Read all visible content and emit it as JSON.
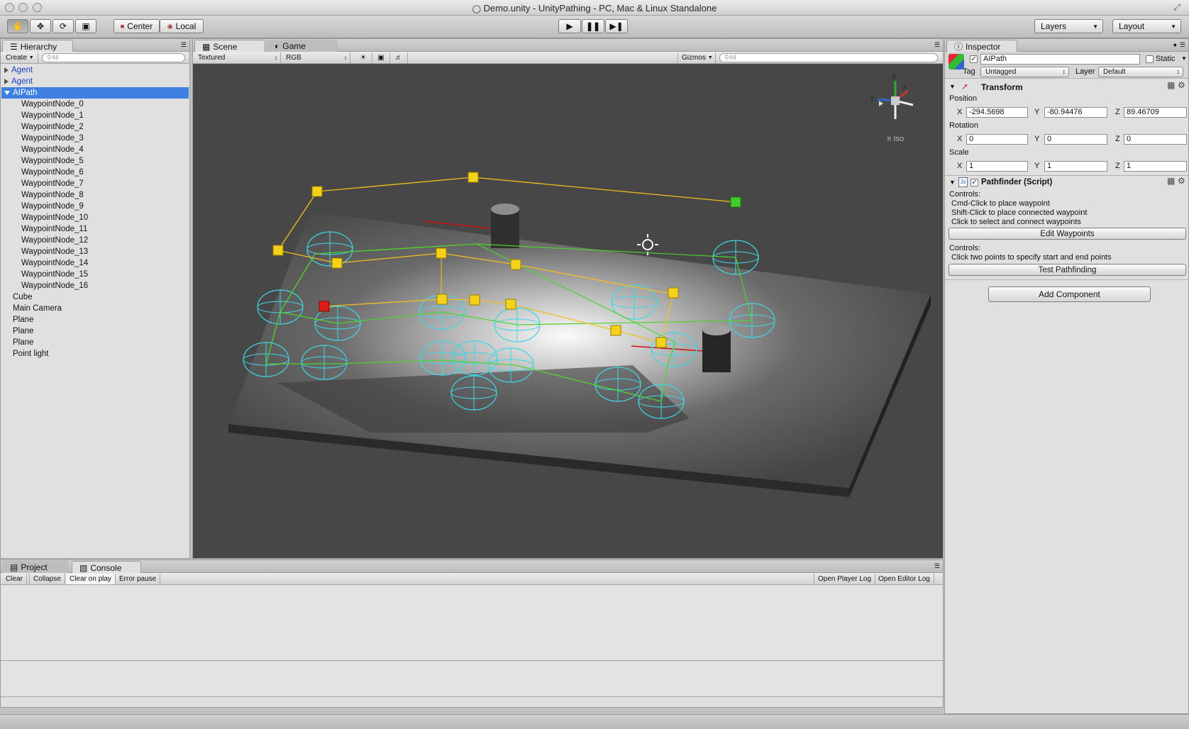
{
  "window": {
    "title": "Demo.unity - UnityPathing - PC, Mac & Linux Standalone"
  },
  "toolbar": {
    "pivot_label": "Center",
    "space_label": "Local",
    "layers_label": "Layers",
    "layout_label": "Layout"
  },
  "hierarchy": {
    "tab_label": "Hierarchy",
    "create_label": "Create",
    "search_placeholder": "All",
    "items": [
      {
        "label": "Agent",
        "indent": 0,
        "expand": "closed",
        "color": "#1a3fbf"
      },
      {
        "label": "Agent",
        "indent": 0,
        "expand": "closed",
        "color": "#1a3fbf"
      },
      {
        "label": "AIPath",
        "indent": 0,
        "expand": "open",
        "selected": true
      },
      {
        "label": "WaypointNode_0",
        "indent": 2
      },
      {
        "label": "WaypointNode_1",
        "indent": 2
      },
      {
        "label": "WaypointNode_2",
        "indent": 2
      },
      {
        "label": "WaypointNode_3",
        "indent": 2
      },
      {
        "label": "WaypointNode_4",
        "indent": 2
      },
      {
        "label": "WaypointNode_5",
        "indent": 2
      },
      {
        "label": "WaypointNode_6",
        "indent": 2
      },
      {
        "label": "WaypointNode_7",
        "indent": 2
      },
      {
        "label": "WaypointNode_8",
        "indent": 2
      },
      {
        "label": "WaypointNode_9",
        "indent": 2
      },
      {
        "label": "WaypointNode_10",
        "indent": 2
      },
      {
        "label": "WaypointNode_11",
        "indent": 2
      },
      {
        "label": "WaypointNode_12",
        "indent": 2
      },
      {
        "label": "WaypointNode_13",
        "indent": 2
      },
      {
        "label": "WaypointNode_14",
        "indent": 2
      },
      {
        "label": "WaypointNode_15",
        "indent": 2
      },
      {
        "label": "WaypointNode_16",
        "indent": 2
      },
      {
        "label": "Cube",
        "indent": 1
      },
      {
        "label": "Main Camera",
        "indent": 1
      },
      {
        "label": "Plane",
        "indent": 1
      },
      {
        "label": "Plane",
        "indent": 1
      },
      {
        "label": "Plane",
        "indent": 1
      },
      {
        "label": "Point light",
        "indent": 1
      }
    ]
  },
  "scene": {
    "tab_label": "Scene",
    "game_tab_label": "Game",
    "render_mode": "Textured",
    "channel": "RGB",
    "gizmos_label": "Gizmos",
    "search_placeholder": "All",
    "iso_label": "Iso",
    "axis_x": "x",
    "axis_y": "y",
    "axis_z": "z"
  },
  "console": {
    "project_tab_label": "Project",
    "console_tab_label": "Console",
    "clear_label": "Clear",
    "collapse_label": "Collapse",
    "clear_on_play_label": "Clear on play",
    "error_pause_label": "Error pause",
    "open_player_log_label": "Open Player Log",
    "open_editor_log_label": "Open Editor Log"
  },
  "inspector": {
    "tab_label": "Inspector",
    "object_name": "AIPath",
    "static_label": "Static",
    "tag_label": "Tag",
    "tag_value": "Untagged",
    "layer_label": "Layer",
    "layer_value": "Default",
    "transform": {
      "title": "Transform",
      "position_label": "Position",
      "rotation_label": "Rotation",
      "scale_label": "Scale",
      "x_label": "X",
      "y_label": "Y",
      "z_label": "Z",
      "position": {
        "x": "-294.5698",
        "y": "-80.94476",
        "z": "89.46709"
      },
      "rotation": {
        "x": "0",
        "y": "0",
        "z": "0"
      },
      "scale": {
        "x": "1",
        "y": "1",
        "z": "1"
      }
    },
    "pathfinder": {
      "title": "Pathfinder (Script)",
      "controls1_label": "Controls:",
      "line1": "Cmd-Click to place waypoint",
      "line2": "Shift-Click to place connected waypoint",
      "line3": "Click to select and connect waypoints",
      "edit_button": "Edit Waypoints",
      "controls2_label": "Controls:",
      "line4": "Click two points to specify start and end points",
      "test_button": "Test Pathfinding"
    },
    "add_component_label": "Add Component"
  }
}
